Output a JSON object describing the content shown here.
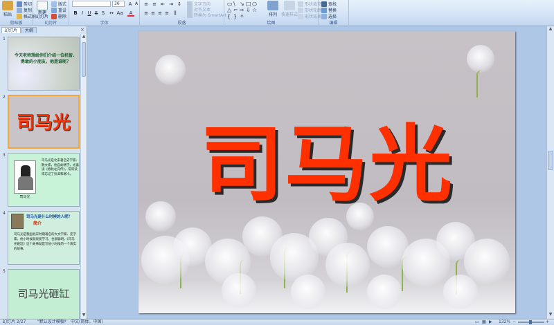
{
  "ribbon": {
    "clipboard": {
      "label": "剪贴板",
      "paste": "粘贴",
      "cut": "剪切",
      "copy": "复制",
      "format_painter": "格式刷"
    },
    "slides": {
      "label": "幻灯片",
      "new_slide": "新建\n幻灯片",
      "layout": "版式",
      "reset": "重设",
      "delete": "删除"
    },
    "font": {
      "label": "字体",
      "font_name": "",
      "font_size": "36"
    },
    "paragraph": {
      "label": "段落",
      "text_direction": "文字方向",
      "align_text": "对齐文本",
      "smartart": "转换为 SmartArt"
    },
    "drawing": {
      "label": "绘图",
      "arrange": "排列",
      "quick_styles": "快速样式",
      "shape_fill": "形状填充",
      "shape_outline": "形状轮廓",
      "shape_effects": "形状效果"
    },
    "editing": {
      "label": "编辑",
      "find": "查找",
      "replace": "替换",
      "select": "选择"
    }
  },
  "panel": {
    "tabs": [
      "幻灯片",
      "大纲"
    ],
    "close": "×"
  },
  "thumbnails": [
    {
      "num": "1",
      "text": "今天老师想给你们介绍一位机智、勇敢的小朋友，他是谁呢？"
    },
    {
      "num": "2",
      "text": "司马光"
    },
    {
      "num": "3",
      "text": "司马光是北宋著名史学家、散文家，他自幼嗜学，尤喜读《春秋左氏传》，常常读得忘记了饥渴和寒冷。",
      "caption": "司马光"
    },
    {
      "num": "4",
      "title": "司马光是什么时候的人呢？",
      "subtitle": "简介",
      "text": "司马光是我国北宋时期著名的大文学家、史学家。他小时候就很爱学习，也很聪明。《司马光砸缸》这个故事就是写他小时候的一个真实的故事。"
    },
    {
      "num": "5",
      "text": "司马光砸缸"
    }
  ],
  "slide": {
    "title": "司马光"
  },
  "status": {
    "slide_info": "幻灯片 2/27",
    "theme": "\"默认设计模板\"",
    "language": "中文(简体，中国)",
    "zoom": "132%"
  },
  "colors": {
    "title_red": "#ff3000",
    "ribbon_bg": "#dde9f7",
    "selection": "#f4a432"
  }
}
